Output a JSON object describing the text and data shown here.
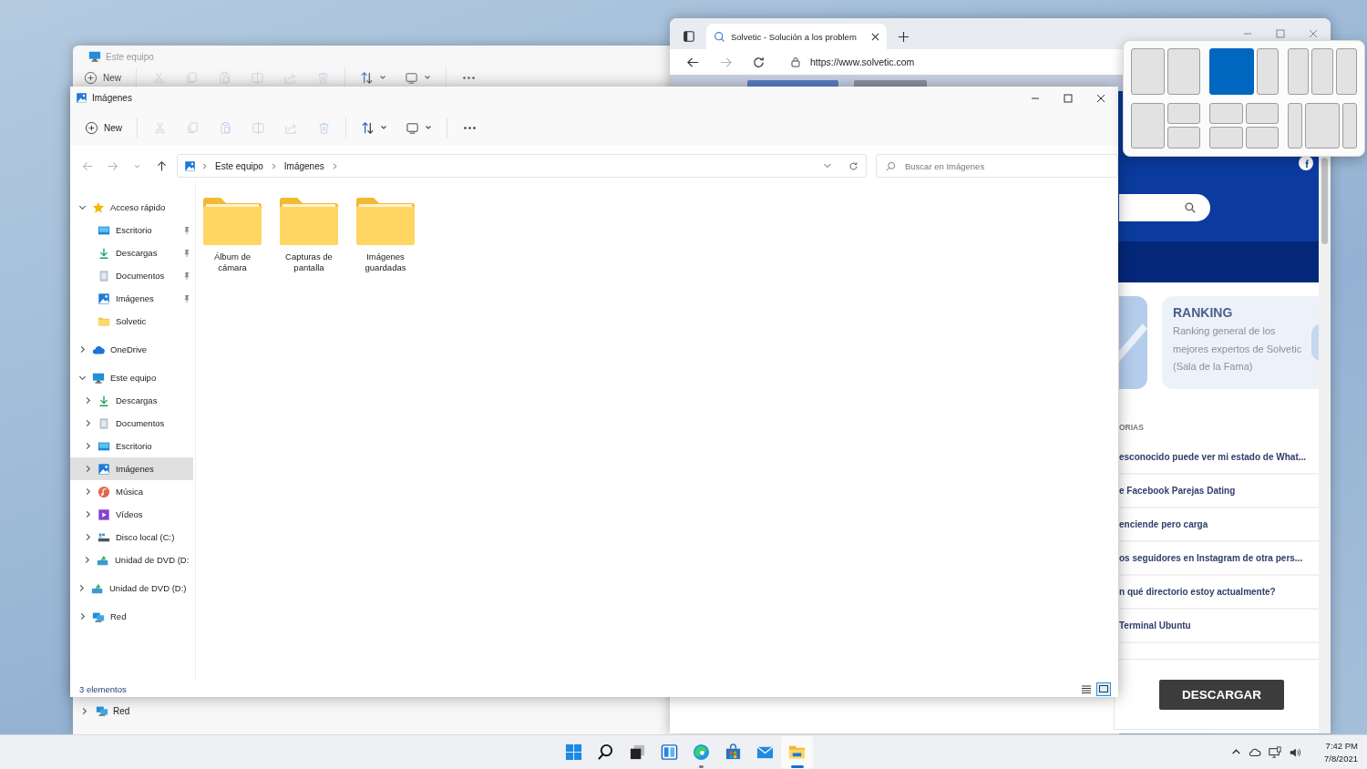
{
  "back_window": {
    "title": "Este equipo",
    "toolbar": [
      {
        "kind": "new",
        "label": "New",
        "disabled": false
      },
      {
        "kind": "cut",
        "disabled": true
      },
      {
        "kind": "copy",
        "disabled": true
      },
      {
        "kind": "paste",
        "disabled": true
      },
      {
        "kind": "rename",
        "disabled": true
      },
      {
        "kind": "share",
        "disabled": true
      },
      {
        "kind": "delete",
        "disabled": true
      },
      {
        "kind": "sort",
        "disabled": false
      },
      {
        "kind": "view",
        "disabled": false
      },
      {
        "kind": "more",
        "disabled": false
      }
    ],
    "sidebar": [
      {
        "label": "Red",
        "kind": "network",
        "expanded": false
      }
    ]
  },
  "browser": {
    "tab": {
      "title": "Solvetic - Solución a los problem",
      "selected": true
    },
    "nav": [
      {
        "kind": "back",
        "disabled": false
      },
      {
        "kind": "forward",
        "disabled": true
      },
      {
        "kind": "refresh",
        "disabled": false
      }
    ],
    "url": "https://www.solvetic.com",
    "page": {
      "ranking": {
        "title": "RANKING",
        "text": "Ranking general de los mejores expertos de Solvetic (Sala de la Fama)"
      },
      "section_label": "ORIAS",
      "articles": [
        "esconocido puede ver mi estado de What...",
        "e Facebook Parejas Dating",
        "enciende pero carga",
        "os seguidores en Instagram de otra pers...",
        "n qué directorio estoy actualmente?",
        "Terminal Ubuntu"
      ],
      "download_button": "DESCARGAR"
    }
  },
  "explorer": {
    "title": "Imágenes",
    "toolbar": [
      {
        "kind": "new",
        "label": "New",
        "disabled": false
      },
      {
        "kind": "cut",
        "disabled": true
      },
      {
        "kind": "copy",
        "disabled": true
      },
      {
        "kind": "paste",
        "disabled": true
      },
      {
        "kind": "rename",
        "disabled": true
      },
      {
        "kind": "share",
        "disabled": true
      },
      {
        "kind": "delete",
        "disabled": true
      },
      {
        "kind": "sort",
        "disabled": false
      },
      {
        "kind": "view",
        "disabled": false
      },
      {
        "kind": "more",
        "disabled": false
      }
    ],
    "nav": [
      {
        "kind": "back",
        "disabled": true
      },
      {
        "kind": "forward",
        "disabled": true
      },
      {
        "kind": "recent",
        "disabled": true
      },
      {
        "kind": "up",
        "disabled": false
      }
    ],
    "breadcrumb": [
      "Este equipo",
      "Imágenes"
    ],
    "search_placeholder": "Buscar en Imágenes",
    "sidebar": [
      {
        "label": "Acceso rápido",
        "kind": "star",
        "expanded": true,
        "selected": false,
        "children": [
          {
            "label": "Escritorio",
            "kind": "desktop",
            "pinned": true,
            "selected": false
          },
          {
            "label": "Descargas",
            "kind": "download",
            "pinned": true,
            "selected": false
          },
          {
            "label": "Documentos",
            "kind": "document",
            "pinned": true,
            "selected": false
          },
          {
            "label": "Imágenes",
            "kind": "pictures",
            "pinned": true,
            "selected": false
          },
          {
            "label": "Solvetic",
            "kind": "folder",
            "pinned": false,
            "selected": false
          }
        ]
      },
      {
        "label": "OneDrive",
        "kind": "cloud",
        "expanded": false,
        "selected": false
      },
      {
        "label": "Este equipo",
        "kind": "computer",
        "expanded": true,
        "selected": false,
        "children": [
          {
            "label": "Descargas",
            "kind": "download",
            "expanded": false,
            "selected": false
          },
          {
            "label": "Documentos",
            "kind": "document",
            "expanded": false,
            "selected": false
          },
          {
            "label": "Escritorio",
            "kind": "desktop",
            "expanded": false,
            "selected": false
          },
          {
            "label": "Imágenes",
            "kind": "pictures",
            "expanded": false,
            "selected": true
          },
          {
            "label": "Música",
            "kind": "music",
            "expanded": false,
            "selected": false
          },
          {
            "label": "Vídeos",
            "kind": "video",
            "expanded": false,
            "selected": false
          },
          {
            "label": "Disco local (C:)",
            "kind": "drive",
            "expanded": false,
            "selected": false
          },
          {
            "label": "Unidad de DVD (D:",
            "kind": "dvd",
            "expanded": false,
            "selected": false
          }
        ]
      },
      {
        "label": "Unidad de DVD (D:)",
        "kind": "dvd",
        "expanded": false,
        "selected": false
      },
      {
        "label": "Red",
        "kind": "network",
        "expanded": false,
        "selected": false
      }
    ],
    "folders": [
      {
        "name": "Álbum de cámara",
        "selected": false
      },
      {
        "name": "Capturas de pantalla",
        "selected": false
      },
      {
        "name": "Imágenes guardadas",
        "selected": false
      }
    ],
    "status": "3 elementos",
    "views": [
      {
        "kind": "details",
        "selected": false
      },
      {
        "kind": "tiles",
        "selected": true
      }
    ]
  },
  "snap_layouts": [
    {
      "kind": "halves",
      "zones": [
        {
          "selected": false
        },
        {
          "selected": false
        }
      ]
    },
    {
      "kind": "two_thirds",
      "zones": [
        {
          "selected": true
        },
        {
          "selected": false
        }
      ]
    },
    {
      "kind": "thirds",
      "zones": [
        {
          "selected": false
        },
        {
          "selected": false
        },
        {
          "selected": false
        }
      ]
    },
    {
      "kind": "left_stack",
      "zones": [
        {
          "selected": false
        },
        {
          "selected": false
        },
        {
          "selected": false
        }
      ]
    },
    {
      "kind": "quarters",
      "zones": [
        {
          "selected": false
        },
        {
          "selected": false
        },
        {
          "selected": false
        },
        {
          "selected": false
        }
      ]
    },
    {
      "kind": "wide_center",
      "zones": [
        {
          "selected": false
        },
        {
          "selected": false
        },
        {
          "selected": false
        }
      ]
    }
  ],
  "taskbar": {
    "apps": [
      {
        "kind": "start",
        "running": false,
        "focused": false
      },
      {
        "kind": "search",
        "running": false,
        "focused": false
      },
      {
        "kind": "task_view",
        "running": false,
        "focused": false
      },
      {
        "kind": "widgets",
        "running": false,
        "focused": false
      },
      {
        "kind": "browser",
        "running": true,
        "focused": false
      },
      {
        "kind": "store",
        "running": false,
        "focused": false
      },
      {
        "kind": "mail",
        "running": false,
        "focused": false
      },
      {
        "kind": "explorer",
        "running": true,
        "focused": true
      }
    ],
    "time": "7:42 PM",
    "date": "7/8/2021"
  }
}
